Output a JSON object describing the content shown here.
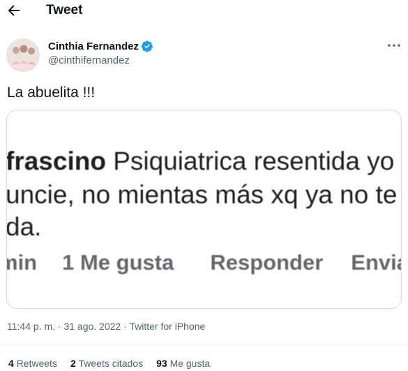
{
  "header": {
    "title": "Tweet",
    "back_icon": "arrow-left-icon"
  },
  "tweet": {
    "author_name": "Cinthia Fernandez",
    "author_handle": "@cinthifernandez",
    "verified_icon": "verified-badge-icon",
    "verified_color": "#1d9bf0",
    "more_icon": "more-horizontal-icon",
    "text": "La abuelita !!!",
    "media": {
      "line1_bold": "frascino",
      "line1_rest": " Psiquiatrica resentida yo t",
      "line2": "uncie, no mientas más xq ya no te",
      "line3": "da.",
      "action_time": "min",
      "action_likes": "1 Me gusta",
      "action_reply": "Responder",
      "action_send": "Envia"
    },
    "timestamp": "11:44 p. m. · 31 ago. 2022 · Twitter for iPhone",
    "stats": {
      "retweets_count": "4",
      "retweets_label": "Retweets",
      "quotes_count": "2",
      "quotes_label": "Tweets citados",
      "likes_count": "93",
      "likes_label": "Me gusta"
    }
  }
}
